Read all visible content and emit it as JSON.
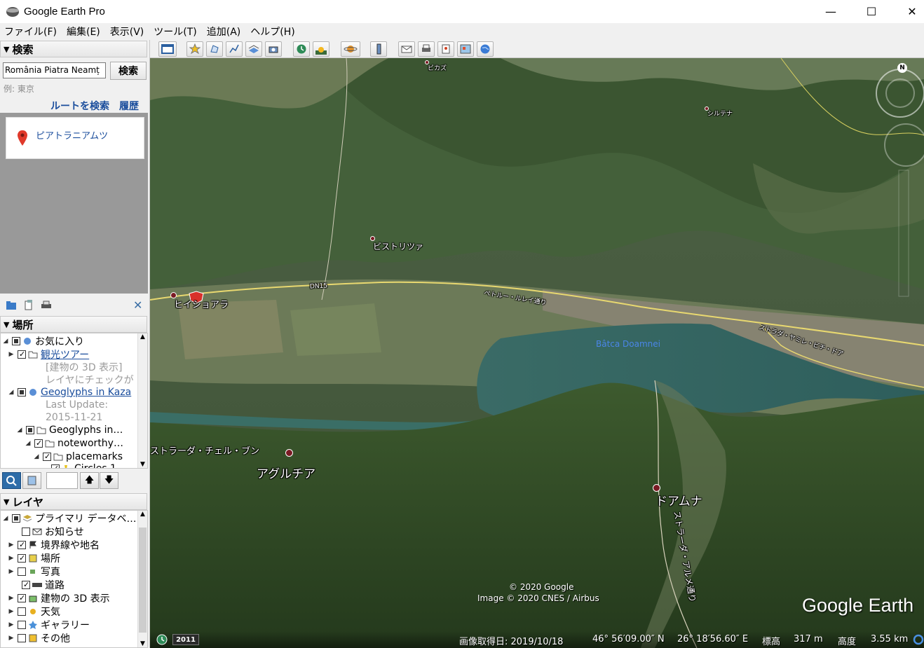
{
  "window": {
    "title": "Google Earth Pro",
    "minimize": "—",
    "maximize": "☐",
    "close": "✕"
  },
  "menu": [
    "ファイル(F)",
    "編集(E)",
    "表示(V)",
    "ツール(T)",
    "追加(A)",
    "ヘルプ(H)"
  ],
  "search": {
    "header": "検索",
    "query": "România  Piatra Neamț",
    "button": "検索",
    "hint": "例: 東京",
    "route_link": "ルートを検索",
    "history_link": "履歴",
    "results": [
      {
        "label": "ピアトラニアムツ"
      }
    ]
  },
  "places": {
    "header": "場所",
    "items": [
      {
        "label": "お気に入り"
      },
      {
        "label": "観光ツアー"
      },
      {
        "label": "[建物の 3D 表示]"
      },
      {
        "label": "レイヤにチェックが"
      },
      {
        "label": "Geoglyphs in Kaza"
      },
      {
        "label": "Last Update:"
      },
      {
        "label": "2015-11-21"
      },
      {
        "label": "Geoglyphs in…"
      },
      {
        "label": "noteworthy…"
      },
      {
        "label": "placemarks"
      },
      {
        "label": "Circles 1"
      }
    ]
  },
  "layers": {
    "header": "レイヤ",
    "items": [
      {
        "label": "プライマリ データベ…"
      },
      {
        "label": "お知らせ"
      },
      {
        "label": "境界線や地名"
      },
      {
        "label": "場所"
      },
      {
        "label": "写真"
      },
      {
        "label": "道路"
      },
      {
        "label": "建物の 3D 表示"
      },
      {
        "label": "天気"
      },
      {
        "label": "ギャラリー"
      },
      {
        "label": "その他"
      }
    ]
  },
  "map": {
    "labels": {
      "bicaz": "ビカズ",
      "piatra": "ピアトラニアムツ",
      "bistricioara": "ビストリツァ",
      "hoisoara": "ヒイショアラ",
      "dn15": "DN15",
      "road_label": "ペトルー・ルレイ通り",
      "lake": "Bâtca Doamnei",
      "aguleru": "アグルチア",
      "doamna": "ドアムナ",
      "cartier": "シルテナ",
      "street1": "ストラーダ・アルメ通り",
      "street2": "ストラーダ・チェル・ブン",
      "street3": "ストラダ・ヤミレ・ビチ・ドア"
    },
    "copyright1": "© 2020 Google",
    "copyright2": "Image © 2020 CNES / Airbus",
    "brand": "Google Earth",
    "year": "2011",
    "compass": "N"
  },
  "status": {
    "date_label": "画像取得日: 2019/10/18",
    "lat": "46° 56′09.00″ N",
    "lon": "26° 18′56.60″ E",
    "elev_label": "標高",
    "elev": "317 m",
    "alt_label": "高度",
    "alt": "3.55 km"
  }
}
